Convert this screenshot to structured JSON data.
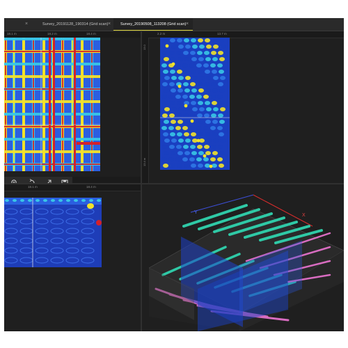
{
  "tabs": [
    {
      "label": "",
      "active": false
    },
    {
      "label": "Survey_20191128_190314 (Grid scan)",
      "active": false
    },
    {
      "label": "Survey_20190508_113208 (Grid scan)",
      "active": true
    }
  ],
  "rulers": {
    "top_left": [
      "18.1 m",
      "18.2 m",
      "18.4 m"
    ],
    "top_mid": [
      "2.2 m",
      "13.7 m"
    ],
    "top_left_y": [
      "13.0",
      "13.4 m"
    ],
    "bottom_left": [
      "18.1 m",
      "18.4 m"
    ]
  },
  "toolbar": {
    "zoom_in_icon": "zoom-in-icon",
    "rotate_icon": "rotate-icon",
    "fit_icon": "fit-icon",
    "save_icon": "save-icon"
  },
  "axes3d": {
    "y_label": "Y",
    "x_label": "X"
  },
  "colors": {
    "background": "#1b1b1b",
    "tab_active_border": "#d9d23a",
    "heat_blue": "#1a3fc0",
    "heat_cyan": "#39c6e6",
    "heat_yellow": "#f2e22a",
    "heat_red": "#d4202a",
    "iso_teal": "#2fc9a6",
    "iso_pink": "#d86cc0"
  }
}
